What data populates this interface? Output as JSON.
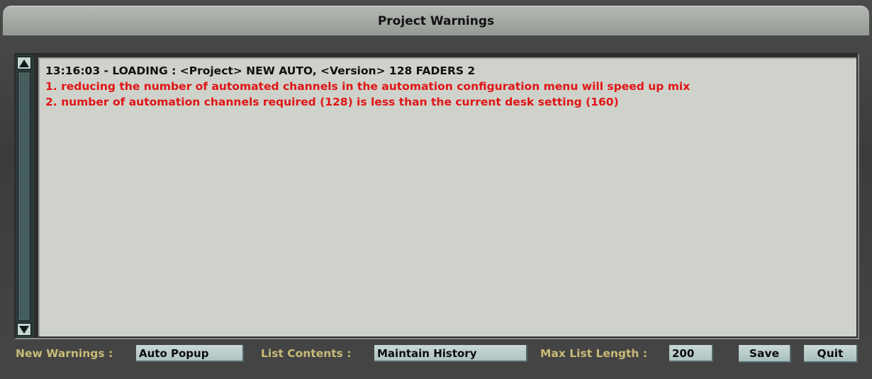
{
  "window": {
    "title": "Project Warnings"
  },
  "log": {
    "lines": [
      {
        "type": "header",
        "text": "13:16:03 - LOADING :  <Project> NEW AUTO, <Version> 128 FADERS 2"
      },
      {
        "type": "warning",
        "text": "1. reducing the number of automated channels in the automation configuration menu will speed up mix"
      },
      {
        "type": "warning",
        "text": "2. number of automation channels required (128) is less than the current desk setting (160)"
      }
    ]
  },
  "footer": {
    "new_warnings_label": "New Warnings :",
    "new_warnings_value": "Auto Popup",
    "list_contents_label": "List Contents :",
    "list_contents_value": "Maintain History",
    "max_list_length_label": "Max List Length :",
    "max_list_length_value": "200",
    "save_label": "Save",
    "quit_label": "Quit"
  },
  "icons": {
    "scroll_up": "triangle-up-icon",
    "scroll_down": "triangle-down-icon"
  },
  "colors": {
    "warning_text": "#e11414",
    "label_text": "#c8bb78",
    "list_background": "#ced2cb"
  }
}
